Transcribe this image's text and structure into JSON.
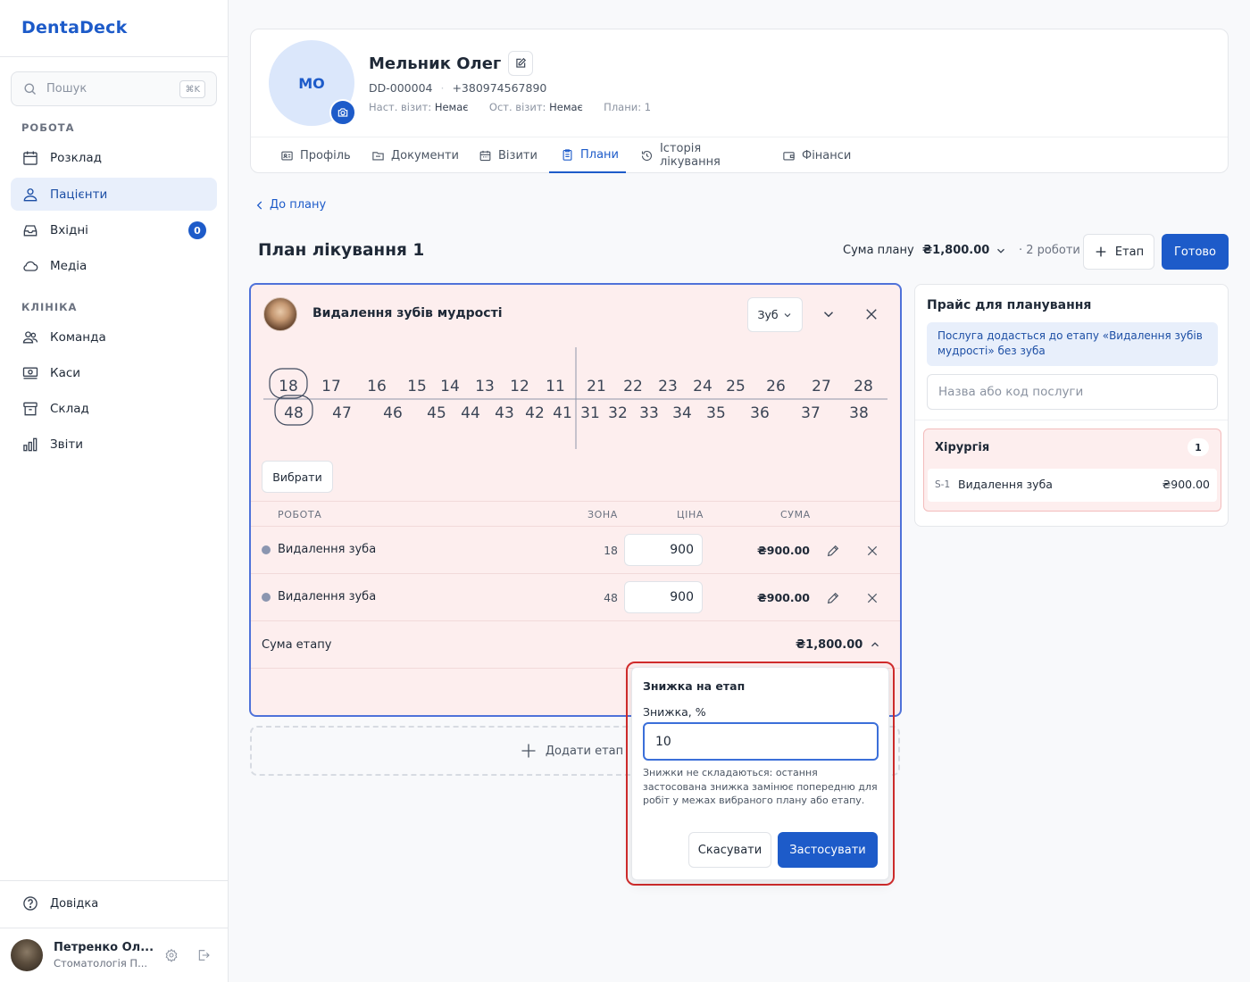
{
  "app": {
    "name": "DentaDeck"
  },
  "sidebar": {
    "search": {
      "placeholder": "Пошук",
      "shortcut": "⌘K"
    },
    "sections": [
      {
        "title": "РОБОТА",
        "items": [
          {
            "label": "Розклад",
            "icon": "calendar-icon"
          },
          {
            "label": "Пацієнти",
            "icon": "patients-icon",
            "active": true
          },
          {
            "label": "Вхідні",
            "icon": "inbox-icon",
            "badge": "0"
          },
          {
            "label": "Медіа",
            "icon": "cloud-icon"
          }
        ]
      },
      {
        "title": "КЛІНІКА",
        "items": [
          {
            "label": "Команда",
            "icon": "team-icon"
          },
          {
            "label": "Каси",
            "icon": "cash-icon"
          },
          {
            "label": "Склад",
            "icon": "archive-icon"
          },
          {
            "label": "Звіти",
            "icon": "chart-icon"
          }
        ]
      }
    ],
    "help": "Довідка",
    "user": {
      "name": "Петренко Ол...",
      "role": "Стоматологія П..."
    }
  },
  "patient": {
    "initials": "МО",
    "name": "Мельник Олег",
    "id": "DD-000004",
    "phone": "+380974567890",
    "next_visit_label": "Наст. візит:",
    "next_visit_value": "Немає",
    "last_visit_label": "Ост. візит:",
    "last_visit_value": "Немає",
    "plans_label": "Плани:",
    "plans_value": "1"
  },
  "tabs": [
    {
      "label": "Профіль",
      "icon": "profile-card-icon"
    },
    {
      "label": "Документи",
      "icon": "folder-icon"
    },
    {
      "label": "Візити",
      "icon": "calendar-icon"
    },
    {
      "label": "Плани",
      "icon": "clipboard-icon",
      "active": true
    },
    {
      "label": "Історія лікування",
      "icon": "history-icon"
    },
    {
      "label": "Фінанси",
      "icon": "wallet-icon"
    }
  ],
  "plan": {
    "back_label": "До плану",
    "title": "План лікування 1",
    "sum_label": "Сума плану",
    "sum_value": "₴1,800.00",
    "works_count": "· 2 роботи",
    "add_stage_button": "Етап",
    "done_button": "Готово"
  },
  "stage": {
    "title": "Видалення зубів мудрості",
    "tooth_select": "Зуб",
    "teeth_upper": [
      "18",
      "17",
      "16",
      "15",
      "14",
      "13",
      "12",
      "11",
      "21",
      "22",
      "23",
      "24",
      "25",
      "26",
      "27",
      "28"
    ],
    "teeth_lower": [
      "48",
      "47",
      "46",
      "45",
      "44",
      "43",
      "42",
      "41",
      "31",
      "32",
      "33",
      "34",
      "35",
      "36",
      "37",
      "38"
    ],
    "selected_teeth": [
      "18",
      "48"
    ],
    "select_button": "Вибрати",
    "table_headers": {
      "work": "РОБОТА",
      "zone": "ЗОНА",
      "price": "ЦІНА",
      "sum": "СУМА"
    },
    "rows": [
      {
        "name": "Видалення зуба",
        "zone": "18",
        "price": "900",
        "sum": "₴900.00"
      },
      {
        "name": "Видалення зуба",
        "zone": "48",
        "price": "900",
        "sum": "₴900.00"
      }
    ],
    "stage_sum_label": "Сума етапу",
    "stage_sum_value": "₴1,800.00"
  },
  "add_stage": "Додати етап",
  "price_panel": {
    "title": "Прайс для планування",
    "info": "Послуга додасться до етапу «Видалення зубів мудрості» без зуба",
    "search_placeholder": "Назва або код послуги",
    "category": {
      "name": "Хірургія",
      "count": "1"
    },
    "items": [
      {
        "code": "S-1",
        "name": "Видалення зуба",
        "price": "₴900.00"
      }
    ]
  },
  "discount_popup": {
    "title": "Знижка на етап",
    "label": "Знижка, %",
    "value": "10",
    "note": "Знижки не складаються: остання застосована знижка замінює попередню для робіт у межах вибраного плану або етапу.",
    "cancel": "Скасувати",
    "apply": "Застосувати"
  },
  "colors": {
    "accent": "#1d5bc9",
    "stage_bg": "#fdeeee",
    "highlight_border": "#d12c2c"
  }
}
